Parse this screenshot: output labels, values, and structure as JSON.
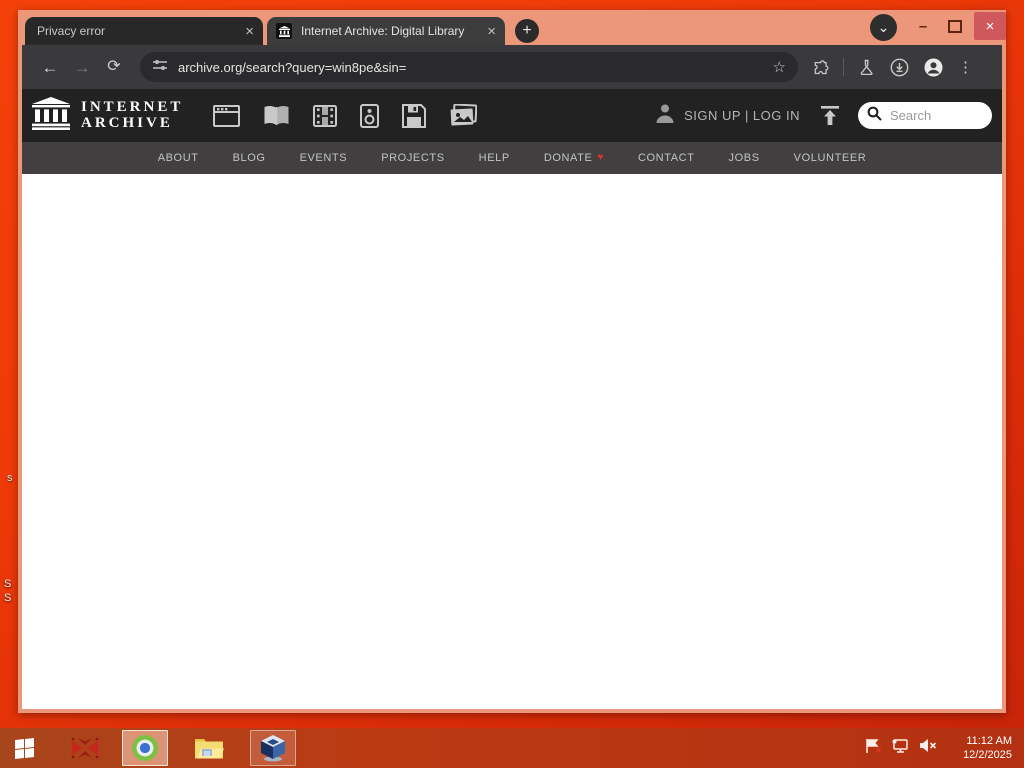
{
  "browser": {
    "tabs": [
      {
        "title": "Privacy error"
      },
      {
        "title": "Internet Archive: Digital Library"
      }
    ],
    "url": "archive.org/search?query=win8pe&sin="
  },
  "icons": {
    "close": "×",
    "plus": "+",
    "chevron_down": "⌄",
    "minimize": "–",
    "back": "←",
    "forward": "→",
    "reload": "⟳",
    "star": "☆",
    "kebab": "⋮",
    "heart": "♥"
  },
  "ia": {
    "logo_line1": "INTERNET",
    "logo_line2": "ARCHIVE",
    "auth": "SIGN UP | LOG IN",
    "search_placeholder": "Search",
    "media_tabs": [
      "web",
      "texts",
      "video",
      "audio",
      "software",
      "images"
    ],
    "nav": [
      {
        "label": "ABOUT"
      },
      {
        "label": "BLOG"
      },
      {
        "label": "EVENTS"
      },
      {
        "label": "PROJECTS"
      },
      {
        "label": "HELP"
      },
      {
        "label": "DONATE"
      },
      {
        "label": "CONTACT"
      },
      {
        "label": "JOBS"
      },
      {
        "label": "VOLUNTEER"
      }
    ]
  },
  "taskbar": {
    "time": "11:12 AM",
    "date": "12/2/2025"
  },
  "desktop": {
    "fragments": [
      "s",
      "S",
      "S"
    ]
  },
  "colors": {
    "desktop_orange": "#ee3a08",
    "frame_salmon": "#ec9779",
    "close_red": "#cf585c",
    "taskbar_red": "#b5330f",
    "header_dark": "#222222",
    "nav_gray": "#413f3f",
    "donate_heart": "#e03131",
    "toolbar_dark": "#3a3a3c"
  }
}
